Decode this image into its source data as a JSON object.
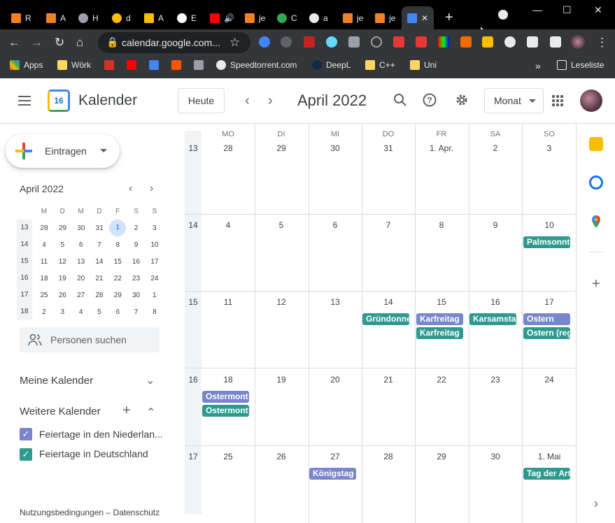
{
  "browser": {
    "tabs": [
      {
        "label": "R",
        "color": "#f48024"
      },
      {
        "label": "A",
        "color": "#f48024"
      },
      {
        "label": "H",
        "color": "#9aa0a6"
      },
      {
        "label": "d",
        "color": "#fbbc04"
      },
      {
        "label": "A",
        "color": "#fbbc04"
      },
      {
        "label": "E",
        "color": "#ffffff"
      },
      {
        "label": "",
        "color": "#ff0000"
      },
      {
        "label": "je",
        "color": "#f48024"
      },
      {
        "label": "C",
        "color": "#34a853"
      },
      {
        "label": "a",
        "color": "#e8eaed"
      },
      {
        "label": "je",
        "color": "#f48024"
      },
      {
        "label": "je",
        "color": "#f48024"
      }
    ],
    "active_tab_close": "✕",
    "new_tab": "+",
    "url": "calendar.google.com...",
    "bookmarks": [
      {
        "label": "Apps"
      },
      {
        "label": "Wörk"
      },
      {
        "label": ""
      },
      {
        "label": ""
      },
      {
        "label": ""
      },
      {
        "label": ""
      },
      {
        "label": ""
      },
      {
        "label": "Speedtorrent.com"
      },
      {
        "label": "DeepL"
      },
      {
        "label": "C++"
      },
      {
        "label": "Uni"
      }
    ],
    "more_bookmarks": "»",
    "reading_list": "Leseliste"
  },
  "header": {
    "app_name": "Kalender",
    "logo_day": "16",
    "today_label": "Heute",
    "month_title": "April 2022",
    "view_label": "Monat"
  },
  "sidebar": {
    "create_label": "Eintragen",
    "mini_title": "April 2022",
    "mini_dows": [
      "M",
      "D",
      "M",
      "D",
      "F",
      "S",
      "S"
    ],
    "mini_weeks": [
      {
        "wk": "13",
        "days": [
          "28",
          "29",
          "30",
          "31",
          "1",
          "2",
          "3"
        ]
      },
      {
        "wk": "14",
        "days": [
          "4",
          "5",
          "6",
          "7",
          "8",
          "9",
          "10"
        ]
      },
      {
        "wk": "15",
        "days": [
          "11",
          "12",
          "13",
          "14",
          "15",
          "16",
          "17"
        ]
      },
      {
        "wk": "16",
        "days": [
          "18",
          "19",
          "20",
          "21",
          "22",
          "23",
          "24"
        ]
      },
      {
        "wk": "17",
        "days": [
          "25",
          "26",
          "27",
          "28",
          "29",
          "30",
          "1"
        ]
      },
      {
        "wk": "18",
        "days": [
          "2",
          "3",
          "4",
          "5",
          "6",
          "7",
          "8"
        ]
      }
    ],
    "person_search": "Personen suchen",
    "my_calendars": "Meine Kalender",
    "other_calendars": "Weitere Kalender",
    "calendars": [
      {
        "label": "Feiertage in den Niederlan...",
        "color": "#7986cb"
      },
      {
        "label": "Feiertage in Deutschland",
        "color": "#2e9a8f"
      }
    ],
    "footer": "Nutzungsbedingungen – Datenschutz"
  },
  "grid": {
    "dows": [
      "MO",
      "DI",
      "MI",
      "DO",
      "FR",
      "SA",
      "SO"
    ],
    "weeks": [
      {
        "wk": "13",
        "days": [
          "28",
          "29",
          "30",
          "31",
          "1. Apr.",
          "2",
          "3"
        ]
      },
      {
        "wk": "14",
        "days": [
          "4",
          "5",
          "6",
          "7",
          "8",
          "9",
          "10"
        ]
      },
      {
        "wk": "15",
        "days": [
          "11",
          "12",
          "13",
          "14",
          "15",
          "16",
          "17"
        ]
      },
      {
        "wk": "16",
        "days": [
          "18",
          "19",
          "20",
          "21",
          "22",
          "23",
          "24"
        ]
      },
      {
        "wk": "17",
        "days": [
          "25",
          "26",
          "27",
          "28",
          "29",
          "30",
          "1. Mai"
        ]
      }
    ],
    "events": {
      "palmsonntag": "Palmsonnt",
      "gruendonnerstag": "Gründonne",
      "karfreitag_nl": "Karfreitag",
      "karfreitag_de": "Karfreitag",
      "karsamstag": "Karsamsta",
      "ostern_nl": "Ostern",
      "ostern_de": "Ostern (reg",
      "ostermontag_nl": "Ostermont",
      "ostermontag_de": "Ostermont",
      "koenigstag": "Königstag",
      "tag_der_arbeit": "Tag der Art"
    }
  },
  "colors": {
    "nl_holidays": "#7986cb",
    "de_holidays": "#2e9a8f",
    "accent": "#1a73e8"
  }
}
